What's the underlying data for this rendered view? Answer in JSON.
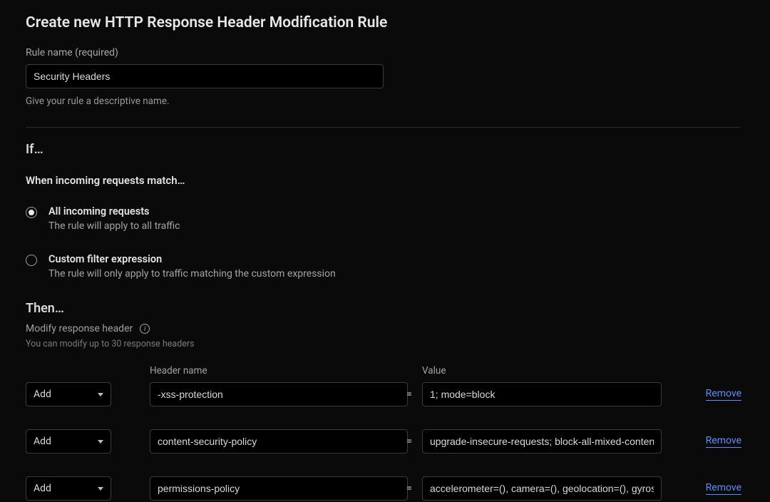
{
  "title": "Create new HTTP Response Header Modification Rule",
  "rule_name": {
    "label": "Rule name (required)",
    "value": "Security Headers",
    "helper": "Give your rule a descriptive name."
  },
  "if_section": {
    "heading": "If…",
    "subheading": "When incoming requests match…",
    "options": [
      {
        "title": "All incoming requests",
        "desc": "The rule will apply to all traffic",
        "selected": true
      },
      {
        "title": "Custom filter expression",
        "desc": "The rule will only apply to traffic matching the custom expression",
        "selected": false
      }
    ]
  },
  "then_section": {
    "heading": "Then…",
    "modify_label": "Modify response header",
    "limit_text": "You can modify up to 30 response headers",
    "cols": {
      "header_name": "Header name",
      "value": "Value"
    },
    "action_label": "Add",
    "equals": "=",
    "remove_label": "Remove",
    "rows": [
      {
        "action": "Add",
        "name": "-xss-protection",
        "value": "1; mode=block"
      },
      {
        "action": "Add",
        "name": "content-security-policy",
        "value": "upgrade-insecure-requests; block-all-mixed-content"
      },
      {
        "action": "Add",
        "name": "permissions-policy",
        "value": "accelerometer=(), camera=(), geolocation=(), gyroscope=()"
      }
    ]
  }
}
